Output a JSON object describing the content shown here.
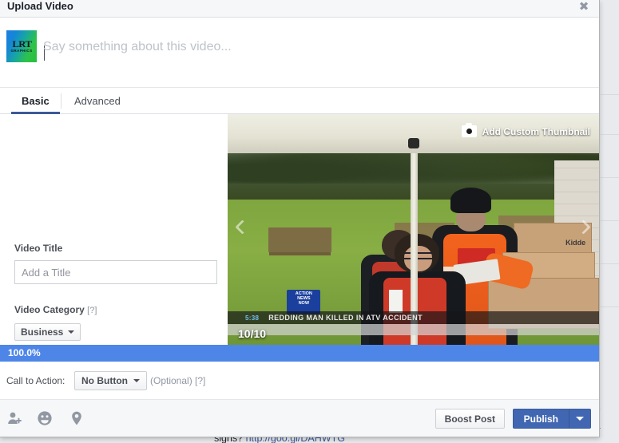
{
  "modal": {
    "title": "Upload Video",
    "close_icon": "close-icon",
    "close_glyph": "✖"
  },
  "composer": {
    "avatar_logo_main": "LRT",
    "avatar_logo_sub": "GRAPHICS",
    "placeholder": "Say something about this video...",
    "value": ""
  },
  "tabs": [
    {
      "label": "Basic",
      "active": true
    },
    {
      "label": "Advanced",
      "active": false
    }
  ],
  "form": {
    "video_title_label": "Video Title",
    "video_title_placeholder": "Add a Title",
    "video_title_value": "",
    "video_category_label": "Video Category",
    "video_category_help": "[?]",
    "video_category_value": "Business"
  },
  "video": {
    "add_thumbnail_label": "Add Custom Thumbnail",
    "camera_icon": "camera-icon",
    "frame_counter": "10/10",
    "prev_icon": "chevron-left-icon",
    "next_icon": "chevron-right-icon",
    "chyron_time": "5:38",
    "chyron_headline": "REDDING MAN KILLED IN ATV ACCIDENT",
    "overlay_logo_line1": "ACTION",
    "overlay_logo_line2": "NEWS",
    "overlay_logo_line3": "NOW",
    "box_brand": "Kidde"
  },
  "progress": {
    "percent_label": "100.0%",
    "percent_value": 100,
    "fill_color": "#4e86e8",
    "track_color": "#dfe1e5"
  },
  "cta": {
    "label": "Call to Action:",
    "button_value": "No Button",
    "optional_text": "(Optional)",
    "help": "[?]"
  },
  "footer": {
    "icons": [
      {
        "name": "tag-people-icon"
      },
      {
        "name": "emoji-icon"
      },
      {
        "name": "location-icon"
      }
    ],
    "boost_label": "Boost Post",
    "publish_label": "Publish",
    "publish_caret_icon": "caret-down-icon"
  },
  "background": {
    "post_text_prefix": "signs? ",
    "post_link": "http://goo.gl/DAHWTG"
  },
  "colors": {
    "accent_blue": "#4267b2",
    "progress_blue": "#4e86e8",
    "tab_underline": "#3b5998",
    "text_primary": "#1d2129",
    "text_secondary": "#4b4f56",
    "text_muted": "#9197a3",
    "page_bg": "#e9eaed"
  }
}
